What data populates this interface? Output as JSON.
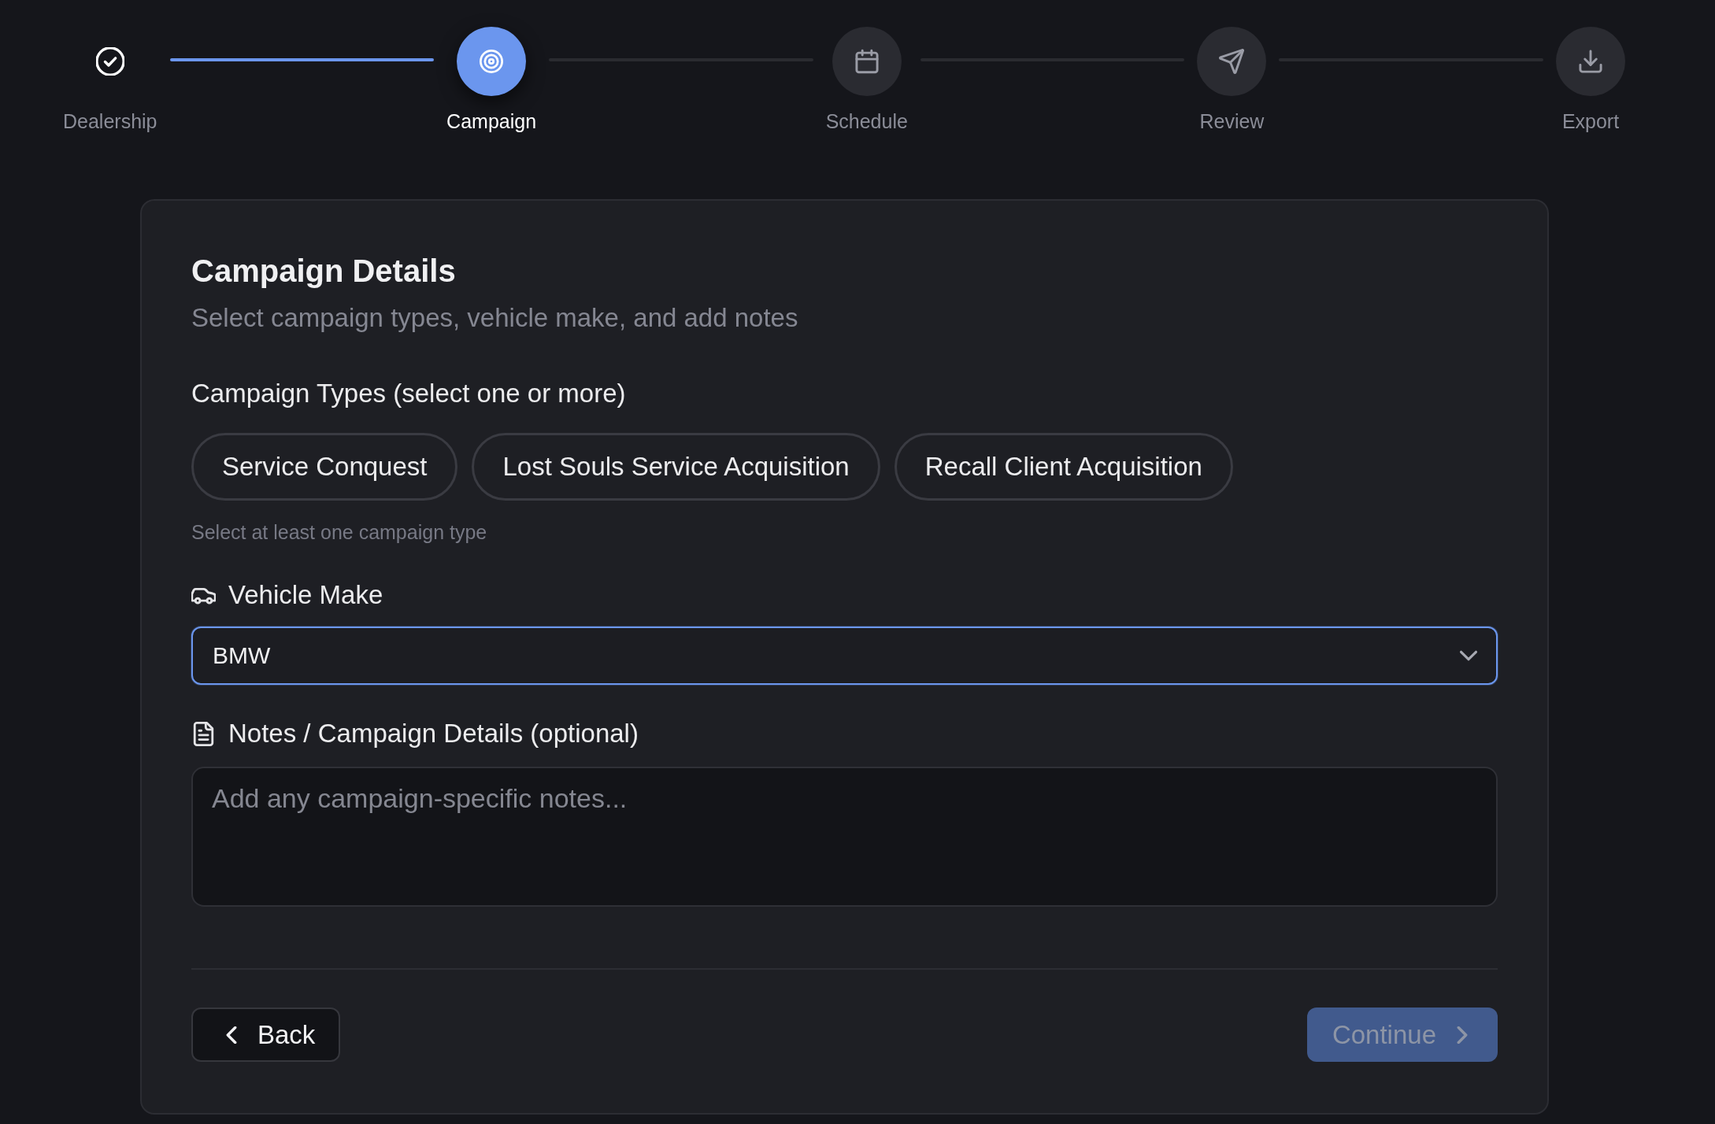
{
  "stepper": {
    "steps": [
      {
        "label": "Dealership",
        "completed": true,
        "selected": false
      },
      {
        "label": "Campaign",
        "completed": false,
        "selected": true
      },
      {
        "label": "Schedule",
        "completed": false,
        "selected": false
      },
      {
        "label": "Review",
        "completed": false,
        "selected": false
      },
      {
        "label": "Export",
        "completed": false,
        "selected": false
      }
    ]
  },
  "card": {
    "title": "Campaign Details",
    "subtitle": "Select campaign types, vehicle make, and add notes",
    "campaign_types": {
      "label": "Campaign Types (select one or more)",
      "options": [
        {
          "label": "Service Conquest",
          "selected": false
        },
        {
          "label": "Lost Souls Service Acquisition",
          "selected": false
        },
        {
          "label": "Recall Client Acquisition",
          "selected": false
        }
      ],
      "hint": "Select at least one campaign type"
    },
    "vehicle_make": {
      "label": "Vehicle Make",
      "value": "BMW",
      "focused": true
    },
    "notes": {
      "label": "Notes / Campaign Details (optional)",
      "placeholder": "Add any campaign-specific notes..."
    },
    "actions": {
      "back": {
        "label": "Back"
      },
      "continue": {
        "label": "Continue",
        "disabled": true
      }
    }
  }
}
